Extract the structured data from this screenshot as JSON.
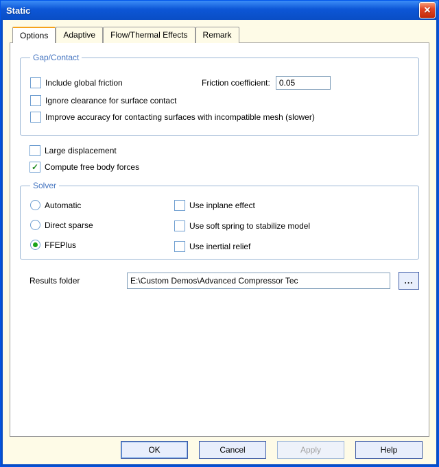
{
  "window": {
    "title": "Static"
  },
  "tabs": [
    {
      "label": "Options",
      "active": true
    },
    {
      "label": "Adaptive",
      "active": false
    },
    {
      "label": "Flow/Thermal Effects",
      "active": false
    },
    {
      "label": "Remark",
      "active": false
    }
  ],
  "gap_contact": {
    "legend": "Gap/Contact",
    "include_global_friction": {
      "label": "Include global friction",
      "checked": false
    },
    "friction_coeff_label": "Friction coefficient:",
    "friction_coeff_value": "0.05",
    "ignore_clearance": {
      "label": "Ignore clearance for surface contact",
      "checked": false
    },
    "improve_accuracy": {
      "label": "Improve accuracy for contacting surfaces with incompatible mesh (slower)",
      "checked": false
    }
  },
  "large_displacement": {
    "label": "Large displacement",
    "checked": false
  },
  "compute_free_body": {
    "label": "Compute free body forces",
    "checked": true
  },
  "solver": {
    "legend": "Solver",
    "options": [
      {
        "key": "automatic",
        "label": "Automatic",
        "selected": false
      },
      {
        "key": "direct_sparse",
        "label": "Direct sparse",
        "selected": false
      },
      {
        "key": "ffeplus",
        "label": "FFEPlus",
        "selected": true
      }
    ],
    "use_inplane": {
      "label": "Use inplane effect",
      "checked": false
    },
    "use_soft_spring": {
      "label": "Use soft spring to stabilize model",
      "checked": false
    },
    "use_inertial_relief": {
      "label": "Use inertial relief",
      "checked": false
    }
  },
  "results_folder": {
    "label": "Results folder",
    "value": "E:\\Custom Demos\\Advanced Compressor Tec",
    "browse": "..."
  },
  "buttons": {
    "ok": "OK",
    "cancel": "Cancel",
    "apply": "Apply",
    "help": "Help"
  }
}
